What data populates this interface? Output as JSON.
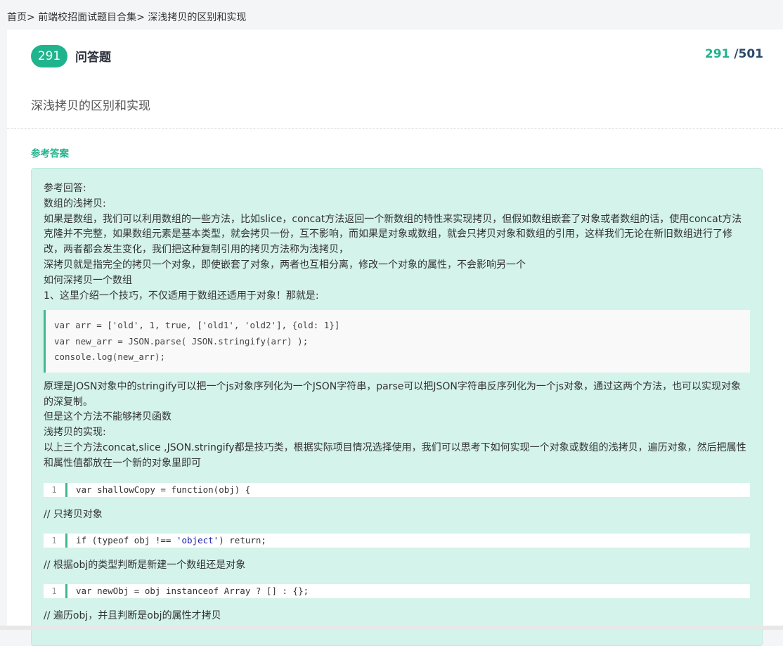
{
  "breadcrumb": {
    "home": "首页",
    "sep": ">",
    "collection": "前端校招面试题目合集",
    "current": "深浅拷贝的区别和实现"
  },
  "question": {
    "number": "291",
    "type": "问答题",
    "current": "291",
    "total": "/501",
    "title": "深浅拷贝的区别和实现"
  },
  "answer": {
    "label": "参考答案",
    "paragraphs_before": [
      "参考回答:",
      "数组的浅拷贝:",
      "如果是数组，我们可以利用数组的一些方法，比如slice，concat方法返回一个新数组的特性来实现拷贝，但假如数组嵌套了对象或者数组的话，使用concat方法克隆并不完整，如果数组元素是基本类型，就会拷贝一份，互不影响，而如果是对象或数组，就会只拷贝对象和数组的引用，这样我们无论在新旧数组进行了修改，两者都会发生变化，我们把这种复制引用的拷贝方法称为浅拷贝，",
      "深拷贝就是指完全的拷贝一个对象，即使嵌套了对象，两者也互相分离，修改一个对象的属性，不会影响另一个",
      "如何深拷贝一个数组",
      "1、这里介绍一个技巧，不仅适用于数组还适用于对象！那就是:"
    ],
    "quote_code": [
      "var arr = ['old', 1, true, ['old1', 'old2'], {old: 1}]",
      "var new_arr = JSON.parse( JSON.stringify(arr) );",
      "console.log(new_arr);"
    ],
    "paragraphs_after": [
      "原理是JOSN对象中的stringify可以把一个js对象序列化为一个JSON字符串，parse可以把JSON字符串反序列化为一个js对象，通过这两个方法，也可以实现对象的深复制。",
      "但是这个方法不能够拷贝函数",
      "浅拷贝的实现:",
      "以上三个方法concat,slice ,JSON.stringify都是技巧类，根据实际项目情况选择使用，我们可以思考下如何实现一个对象或数组的浅拷贝，遍历对象，然后把属性和属性值都放在一个新的对象里即可"
    ],
    "code1": {
      "line": "1",
      "code": "var shallowCopy = function(obj) {"
    },
    "comment1": "// 只拷贝对象",
    "code2": {
      "line": "1",
      "pre": "if (typeof obj !== ",
      "str": "'object'",
      "post": ") return;"
    },
    "comment2": "// 根据obj的类型判断是新建一个数组还是对象",
    "code3": {
      "line": "1",
      "code": "var newObj = obj instanceof Array ? [] : {};"
    },
    "comment3": "// 遍历obj，并且判断是obj的属性才拷贝"
  },
  "colors": {
    "accent": "#1fb48d",
    "answer_bg": "#d4f3ea",
    "total": "#2b4a6b"
  }
}
